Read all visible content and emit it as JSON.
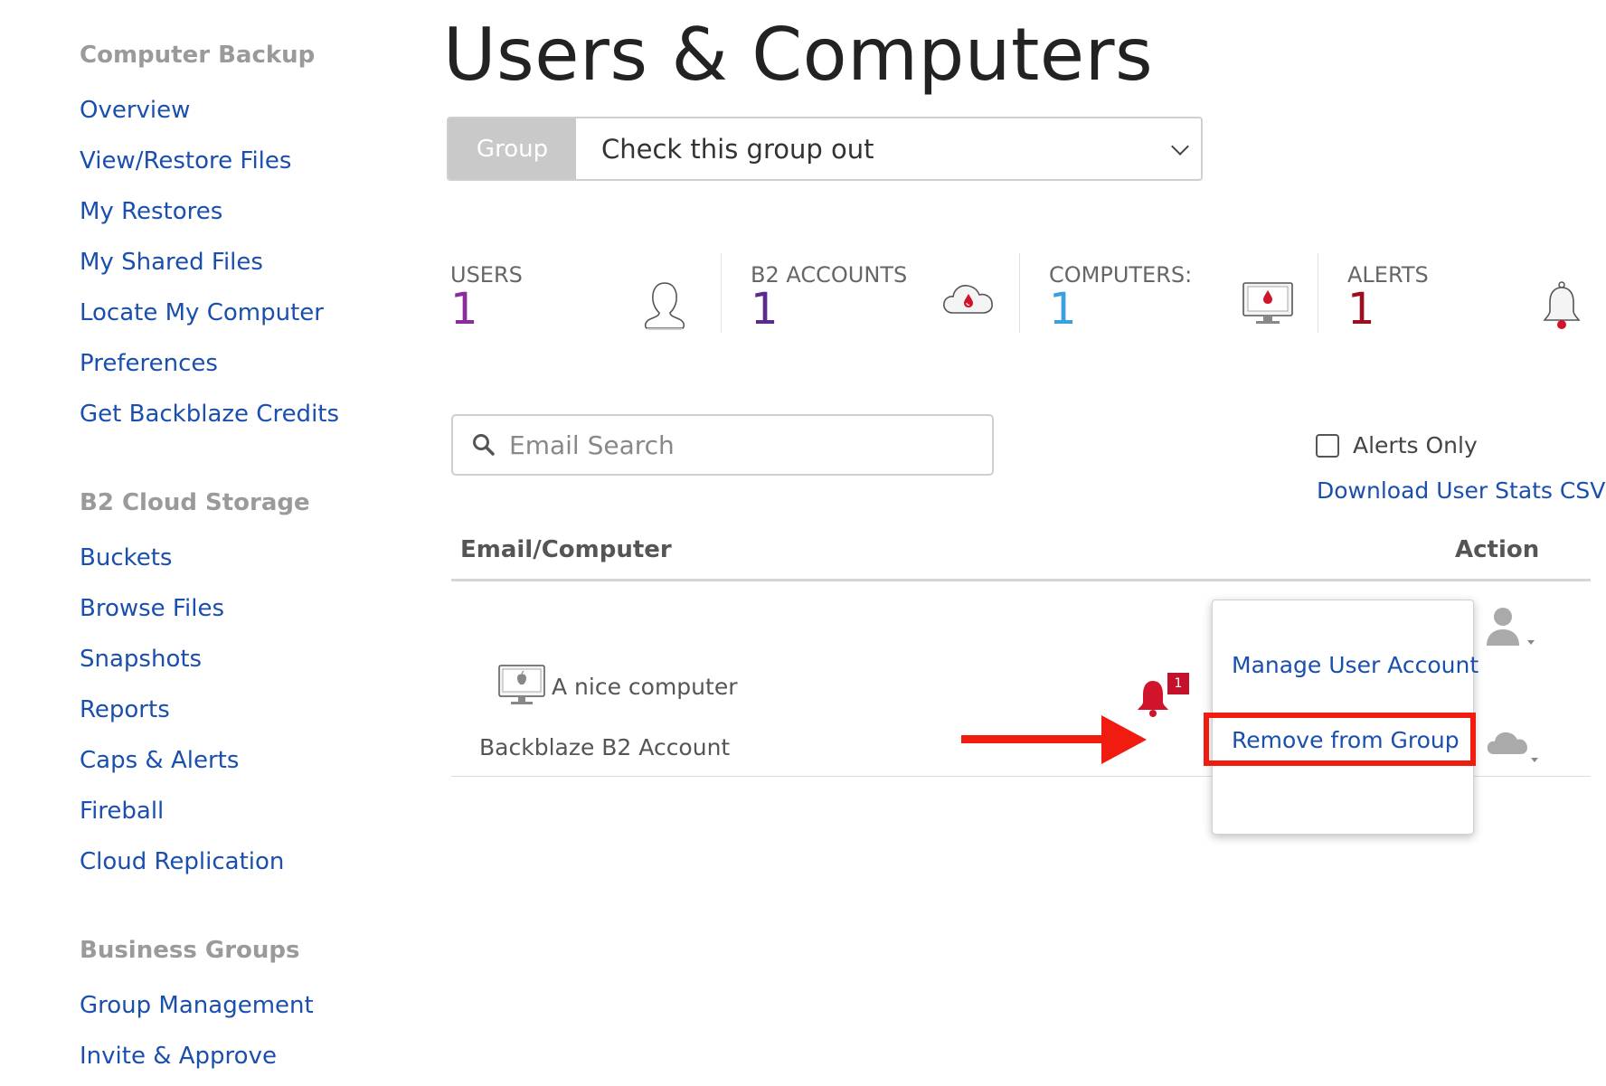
{
  "sidebar": {
    "sections": [
      {
        "heading": "Computer Backup",
        "items": [
          "Overview",
          "View/Restore Files",
          "My Restores",
          "My Shared Files",
          "Locate My Computer",
          "Preferences",
          "Get Backblaze Credits"
        ]
      },
      {
        "heading": "B2 Cloud Storage",
        "items": [
          "Buckets",
          "Browse Files",
          "Snapshots",
          "Reports",
          "Caps & Alerts",
          "Fireball",
          "Cloud Replication"
        ]
      },
      {
        "heading": "Business Groups",
        "items": [
          "Group Management",
          "Invite & Approve"
        ]
      }
    ]
  },
  "page": {
    "title": "Users & Computers"
  },
  "group_select": {
    "label": "Group",
    "value": "Check this group out"
  },
  "stats": [
    {
      "label": "USERS",
      "value": "1",
      "color": "#8a2c9b",
      "icon": "user-icon"
    },
    {
      "label": "B2 ACCOUNTS",
      "value": "1",
      "color": "#5b2a8a",
      "icon": "cloud-icon"
    },
    {
      "label": "COMPUTERS:",
      "value": "1",
      "color": "#3aa0e0",
      "icon": "computer-icon"
    },
    {
      "label": "ALERTS",
      "value": "1",
      "color": "#9b1020",
      "icon": "bell-icon"
    }
  ],
  "search": {
    "placeholder": "Email Search"
  },
  "filters": {
    "alerts_only_label": "Alerts Only",
    "csv_link": "Download User Stats CSV"
  },
  "table": {
    "headers": {
      "email_computer": "Email/Computer",
      "action": "Action"
    },
    "row": {
      "computer_name": "A nice computer",
      "b2_account": "Backblaze B2 Account",
      "alert_count": "1"
    }
  },
  "action_menu": {
    "items": [
      "Manage User Account",
      "Remove from Group"
    ]
  },
  "colors": {
    "link": "#1a4fae",
    "highlight": "#f01c10",
    "alert": "#c4122d"
  }
}
